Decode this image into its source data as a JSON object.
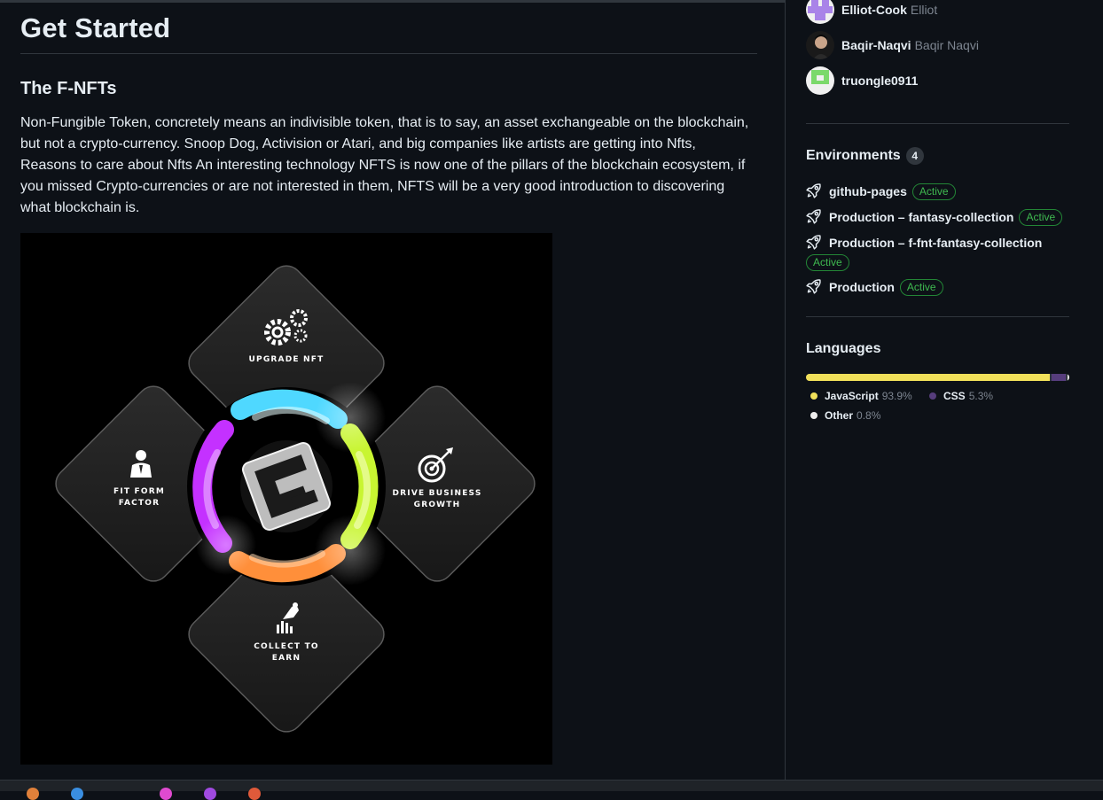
{
  "readme": {
    "title": "Get Started",
    "subtitle": "The F-NFTs",
    "paragraph": "Non-Fungible Token, concretely means an indivisible token, that is to say, an asset exchangeable on the blockchain, but not a crypto-currency. Snoop Dog, Activision or Atari, and big companies like artists are getting into Nfts, Reasons to care about Nfts An interesting technology NFTS is now one of the pillars of the blockchain ecosystem, if you missed Crypto-currencies or are not interested in them, NFTS will be a very good introduction to discovering what blockchain is.",
    "hero": {
      "top_label": "UPGRADE NFT",
      "left_label_1": "FIT FORM",
      "left_label_2": "FACTOR",
      "right_label_1": "DRIVE BUSINESS",
      "right_label_2": "GROWTH",
      "bottom_label_1": "COLLECT TO",
      "bottom_label_2": "EARN"
    }
  },
  "contributors": [
    {
      "login": "Elliot-Cook",
      "name": "Elliot",
      "avatar_color": "#a983e8"
    },
    {
      "login": "Baqir-Naqvi",
      "name": "Baqir Naqvi",
      "avatar_color": "#1a1a1a"
    },
    {
      "login": "truongle0911",
      "name": "",
      "avatar_color": "#7bd96b"
    }
  ],
  "environments": {
    "heading": "Environments",
    "count": "4",
    "items": [
      {
        "name": "github-pages",
        "status": "Active"
      },
      {
        "name": "Production – fantasy-collection",
        "status": "Active"
      },
      {
        "name": "Production – f-fnt-fantasy-collection",
        "status": "Active"
      },
      {
        "name": "Production",
        "status": "Active"
      }
    ]
  },
  "languages": {
    "heading": "Languages",
    "items": [
      {
        "name": "JavaScript",
        "percent": "93.9%",
        "share": 93.9,
        "color": "#f1e05a"
      },
      {
        "name": "CSS",
        "percent": "5.3%",
        "share": 5.3,
        "color": "#563d7c"
      },
      {
        "name": "Other",
        "percent": "0.8%",
        "share": 0.8,
        "color": "#ededed"
      }
    ]
  }
}
